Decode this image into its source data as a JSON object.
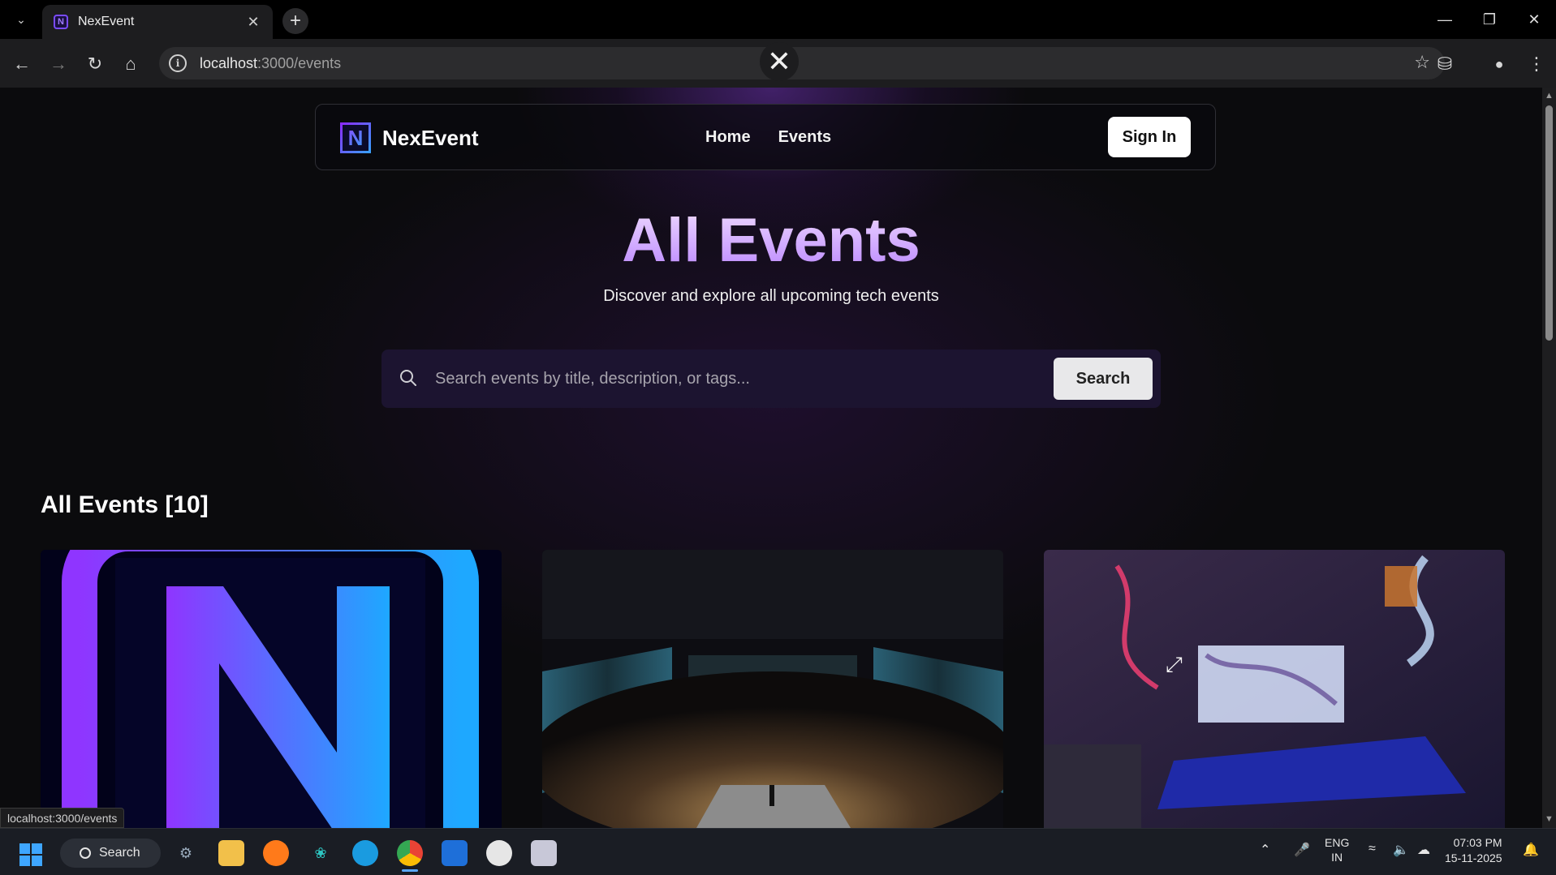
{
  "browser": {
    "tab_title": "NexEvent",
    "tab_favicon_letter": "N",
    "url_host": "localhost",
    "url_path": ":3000/events",
    "status_url": "localhost:3000/events"
  },
  "site": {
    "brand": "NexEvent",
    "logo_letter": "N",
    "nav": [
      {
        "label": "Home"
      },
      {
        "label": "Events"
      }
    ],
    "signin_label": "Sign In"
  },
  "hero": {
    "title": "All Events",
    "subtitle": "Discover and explore all upcoming tech events"
  },
  "search": {
    "placeholder": "Search events by title, description, or tags...",
    "button_label": "Search"
  },
  "events_section": {
    "title": "All Events [10]"
  },
  "taskbar": {
    "search_label": "Search",
    "lang_top": "ENG",
    "lang_bottom": "IN",
    "time": "07:03 PM",
    "date": "15-11-2025"
  },
  "colors": {
    "accent_purple": "#b985ff",
    "brand_gradient_start": "#8a2bff",
    "brand_gradient_end": "#3aa0ff"
  }
}
